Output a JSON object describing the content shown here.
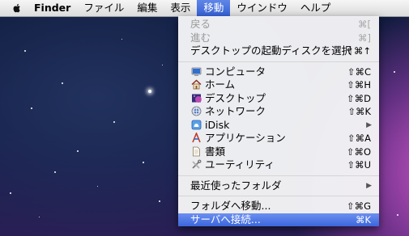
{
  "menubar": {
    "app": "Finder",
    "items": [
      "ファイル",
      "編集",
      "表示",
      "移動",
      "ウインドウ",
      "ヘルプ"
    ],
    "active_index": 3
  },
  "go_menu": {
    "back": {
      "label": "戻る",
      "shortcut": "⌘["
    },
    "forward": {
      "label": "進む",
      "shortcut": "⌘]"
    },
    "startup_disk": {
      "label": "デスクトップの起動ディスクを選択",
      "shortcut": "⇧⌘↑"
    },
    "computer": {
      "label": "コンピュータ",
      "shortcut": "⇧⌘C"
    },
    "home": {
      "label": "ホーム",
      "shortcut": "⇧⌘H"
    },
    "desktop": {
      "label": "デスクトップ",
      "shortcut": "⇧⌘D"
    },
    "network": {
      "label": "ネットワーク",
      "shortcut": "⇧⌘K"
    },
    "idisk": {
      "label": "iDisk"
    },
    "applications": {
      "label": "アプリケーション",
      "shortcut": "⇧⌘A"
    },
    "documents": {
      "label": "書類",
      "shortcut": "⇧⌘O"
    },
    "utilities": {
      "label": "ユーティリティ",
      "shortcut": "⇧⌘U"
    },
    "recent_folders": {
      "label": "最近使ったフォルダ"
    },
    "go_to_folder": {
      "label": "フォルダへ移動...",
      "shortcut": "⇧⌘G"
    },
    "connect_server": {
      "label": "サーバへ接続...",
      "shortcut": "⌘K"
    }
  },
  "colors": {
    "highlight": "#3c66dc",
    "menubar_bg": "#e8e8e8"
  }
}
